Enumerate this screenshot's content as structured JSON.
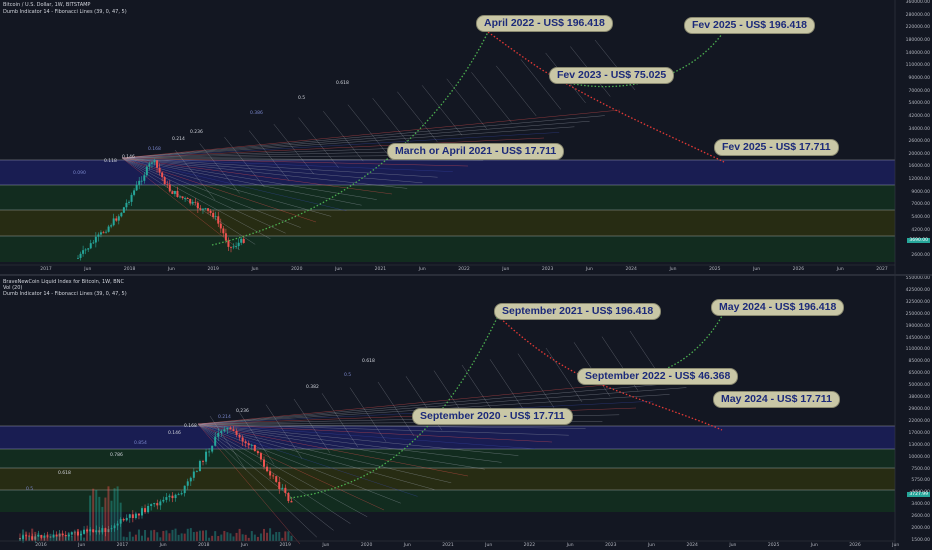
{
  "chart_data": [
    {
      "type": "candlestick",
      "header": {
        "symbol": "Bitcoin / U.S. Dollar, 1W, BITSTAMP",
        "indicator": "Dumb Indicator 14 - Fibonacci Lines (39, 0, 47, 5)"
      },
      "y_scale": "log",
      "y_ticks": [
        "360000.00",
        "280000.00",
        "220000.00",
        "180000.00",
        "140000.00",
        "110000.00",
        "90000.00",
        "70000.00",
        "54000.00",
        "42000.00",
        "34000.00",
        "26000.00",
        "20000.00",
        "16000.00",
        "12000.00",
        "9000.00",
        "7000.00",
        "5400.00",
        "4200.00",
        "3200.00",
        "2600.00"
      ],
      "x_ticks": [
        "2017",
        "Jun",
        "2018",
        "Jun",
        "2019",
        "Jun",
        "2020",
        "Jun",
        "2021",
        "Jun",
        "2022",
        "Jun",
        "2023",
        "Jun",
        "2024",
        "Jun",
        "2025",
        "Jun",
        "2026",
        "Jun",
        "2027"
      ],
      "last_price": "3690.00",
      "fib_labels": [
        "0.090",
        "0.118",
        "0.146",
        "0.168",
        "0.214",
        "0.236",
        "0.386",
        "0.5",
        "0.618"
      ],
      "annotations": [
        {
          "text": "April 2022 - US$ 196.418"
        },
        {
          "text": "Fev 2025 - US$ 196.418"
        },
        {
          "text": "Fev 2023 - US$ 75.025"
        },
        {
          "text": "March or April 2021 - US$ 17.711"
        },
        {
          "text": "Fev 2025 - US$ 17.711"
        }
      ],
      "colors": {
        "bull": "#26a69a",
        "bear": "#ef5350",
        "bull_path": "#4caf50",
        "bear_path": "#e53935",
        "zone_blue": "#1b1f5a",
        "zone_green": "#13301e",
        "zone_olive": "#2c3010"
      }
    },
    {
      "type": "candlestick",
      "header": {
        "symbol": "BraveNewCoin Liquid Index for Bitcoin, 1W, BNC",
        "volume": "Vol (20)",
        "indicator": "Dumb Indicator 14 - Fibonacci Lines (39, 0, 47, 5)"
      },
      "y_scale": "log",
      "y_ticks": [
        "550000.00",
        "425000.00",
        "325000.00",
        "250000.00",
        "190000.00",
        "145000.00",
        "110000.00",
        "85000.00",
        "65000.00",
        "50000.00",
        "38000.00",
        "29000.00",
        "22000.00",
        "17000.00",
        "13000.00",
        "10000.00",
        "7500.00",
        "5750.00",
        "4400.00",
        "3400.00",
        "2600.00",
        "2000.00",
        "1500.00"
      ],
      "x_ticks": [
        "2016",
        "Jun",
        "2017",
        "Jun",
        "2018",
        "Jun",
        "2019",
        "Jun",
        "2020",
        "Jun",
        "2021",
        "Jun",
        "2022",
        "Jun",
        "2023",
        "Jun",
        "2024",
        "Jun",
        "2025",
        "Jun",
        "2026",
        "Jun"
      ],
      "last_price": "3727.99",
      "fib_labels": [
        "0.5",
        "0.618",
        "0.786",
        "0.854",
        "0.146",
        "0.168",
        "0.214",
        "0.236",
        "0.382",
        "0.5",
        "0.618"
      ],
      "annotations": [
        {
          "text": "September 2021 - US$ 196.418"
        },
        {
          "text": "May 2024 - US$ 196.418"
        },
        {
          "text": "September 2022 - US$ 46.368"
        },
        {
          "text": "September 2020 - US$ 17.711"
        },
        {
          "text": "May 2024 - US$ 17.711"
        }
      ],
      "colors": {
        "bull": "#26a69a",
        "bear": "#ef5350",
        "bull_path": "#4caf50",
        "bear_path": "#e53935",
        "zone_blue": "#1b1f5a",
        "zone_green": "#13301e",
        "zone_olive": "#2c3010"
      }
    }
  ]
}
